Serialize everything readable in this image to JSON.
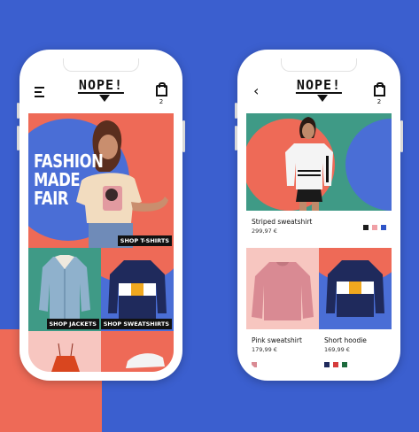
{
  "brand": "NOPE!",
  "phone_left": {
    "cart_count": "2",
    "hero": {
      "title_lines": [
        "FASHION",
        "MADE",
        "FAIR"
      ],
      "button": "SHOP T-SHIRTS"
    },
    "tiles": [
      {
        "button": "SHOP JACKETS"
      },
      {
        "button": "SHOP SWEATSHIRTS"
      }
    ]
  },
  "phone_right": {
    "cart_count": "2",
    "featured": {
      "name": "Striped sweatshirt",
      "price": "299,97 €",
      "swatches": [
        "#1c1c1c",
        "#f0a0a6",
        "#2f55c8"
      ]
    },
    "products": [
      {
        "name": "Pink sweatshirt",
        "price": "179,99 €",
        "swatches": [
          "#d98a93"
        ]
      },
      {
        "name": "Short hoodie",
        "price": "169,99 €",
        "swatches": [
          "#1f2a5c",
          "#d53b3b",
          "#1d6b3d"
        ]
      }
    ]
  },
  "colors": {
    "blue": "#3b5fcf",
    "coral": "#ee6a57",
    "teal": "#3f9a86",
    "pink": "#f7c6c0"
  }
}
